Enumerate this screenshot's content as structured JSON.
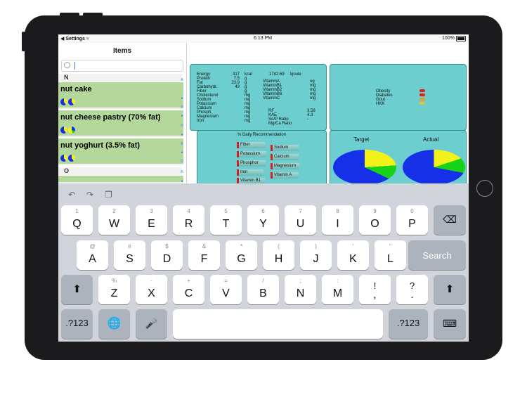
{
  "status": {
    "carrier": "Settings",
    "time": "6:13 PM",
    "battery": "100%"
  },
  "list": {
    "title": "Items",
    "sections": [
      "N",
      "O"
    ],
    "items": [
      {
        "name": "nut cake"
      },
      {
        "name": "nut cheese pastry (70% fat)"
      },
      {
        "name": "nut yoghurt (3.5% fat)"
      }
    ],
    "index": [
      "A",
      "D",
      "H",
      "K",
      "O",
      "R"
    ]
  },
  "nutrients": {
    "col1": [
      "Energy",
      "Protein",
      "Fat",
      "Carbohydr.",
      "Fiber",
      "Cholesterol",
      "Sodium",
      "Potassium",
      "Calcium",
      "Phosph.",
      "Magnesium",
      "Iron"
    ],
    "col1_values": [
      "417",
      "7.5",
      "23.9",
      "43",
      "",
      "",
      "",
      "",
      "",
      "",
      "",
      ""
    ],
    "col1_units": [
      "kcal",
      "g",
      "g",
      "g",
      "g",
      "mg",
      "mg",
      "mg",
      "mg",
      "mg",
      "mg",
      "mg"
    ],
    "kjoule_value": "1742.69",
    "kjoule_unit": "kjoule",
    "vitamins": [
      "VitaminA",
      "VitaminB1",
      "VitaminB2",
      "VitaminB6",
      "VitaminC"
    ],
    "vitamin_units": [
      "ug",
      "mg",
      "mg",
      "mg",
      "mg"
    ],
    "ratios": [
      {
        "label": "RF",
        "value": "3.58"
      },
      {
        "label": "KAE",
        "value": "4.3"
      },
      {
        "label": "So/P Ratio",
        "value": "-"
      },
      {
        "label": "Mg/Ca Ratio",
        "value": ""
      }
    ]
  },
  "conditions": [
    "Obesity",
    "Diabetes",
    "Gout",
    "HKK"
  ],
  "condition_colors": [
    "#e02020",
    "#e02020",
    "#e8a020",
    "#e8c030"
  ],
  "daily": {
    "title": "% Daily Recommendation",
    "left_bars": [
      {
        "label": "Fiber",
        "pct": 0.7
      },
      {
        "label": "Potassium",
        "pct": 0.75
      },
      {
        "label": "Phosphor",
        "pct": 0.72
      },
      {
        "label": "Iron",
        "pct": 0.68
      },
      {
        "label": "Vitamin B1",
        "pct": 0.7
      }
    ],
    "right_bars": [
      {
        "label": "Sodium",
        "pct": 0.7
      },
      {
        "label": "Calcium",
        "pct": 0.7
      },
      {
        "label": "Magnesium",
        "pct": 0.72
      },
      {
        "label": "Vitamin A",
        "pct": 0.7
      }
    ]
  },
  "charts": {
    "target": "Target",
    "actual": "Actual"
  },
  "colors": {
    "panel": "#6ccece",
    "row": "#b4d89c",
    "pie_blue": "#1530e6",
    "pie_yellow": "#f2f21a",
    "pie_green": "#19d21a"
  },
  "keyboard": {
    "row1": [
      {
        "hint": "1",
        "key": "Q"
      },
      {
        "hint": "2",
        "key": "W"
      },
      {
        "hint": "3",
        "key": "E"
      },
      {
        "hint": "4",
        "key": "R"
      },
      {
        "hint": "5",
        "key": "T"
      },
      {
        "hint": "6",
        "key": "Y"
      },
      {
        "hint": "7",
        "key": "U"
      },
      {
        "hint": "8",
        "key": "I"
      },
      {
        "hint": "9",
        "key": "O"
      },
      {
        "hint": "0",
        "key": "P"
      }
    ],
    "row2": [
      {
        "hint": "@",
        "key": "A"
      },
      {
        "hint": "#",
        "key": "S"
      },
      {
        "hint": "$",
        "key": "D"
      },
      {
        "hint": "&",
        "key": "F"
      },
      {
        "hint": "*",
        "key": "G"
      },
      {
        "hint": "(",
        "key": "H"
      },
      {
        "hint": ")",
        "key": "J"
      },
      {
        "hint": "'",
        "key": "K"
      },
      {
        "hint": "\"",
        "key": "L"
      }
    ],
    "row3": [
      {
        "hint": "%",
        "key": "Z"
      },
      {
        "hint": "-",
        "key": "X"
      },
      {
        "hint": "+",
        "key": "C"
      },
      {
        "hint": "=",
        "key": "V"
      },
      {
        "hint": "/",
        "key": "B"
      },
      {
        "hint": ";",
        "key": "N"
      },
      {
        "hint": ":",
        "key": "M"
      },
      {
        "hint": "!",
        "key": ","
      },
      {
        "hint": "?",
        "key": "."
      }
    ],
    "search": "Search",
    "numbers": ".?123",
    "undo_icons": [
      "undo-icon",
      "redo-icon",
      "paste-icon"
    ]
  }
}
